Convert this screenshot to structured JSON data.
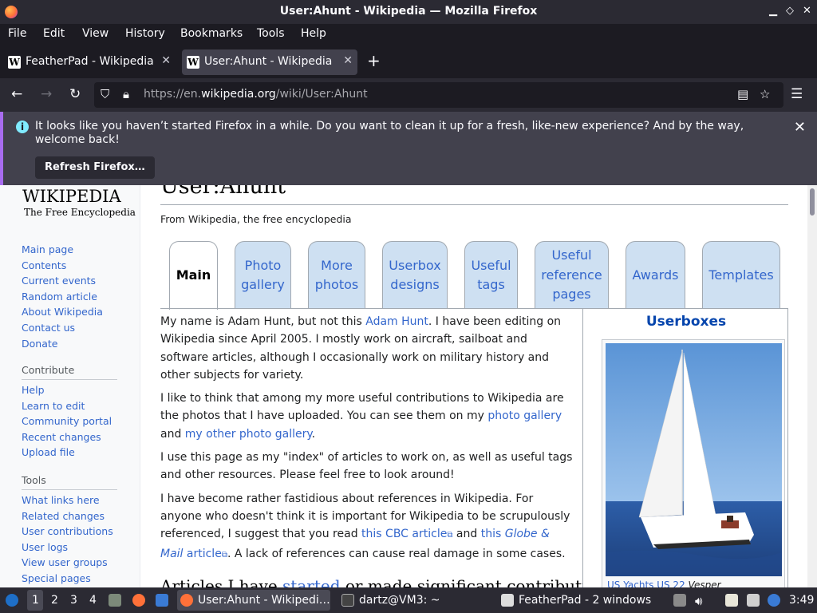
{
  "window": {
    "title": "User:Ahunt - Wikipedia — Mozilla Firefox"
  },
  "menu": [
    "File",
    "Edit",
    "View",
    "History",
    "Bookmarks",
    "Tools",
    "Help"
  ],
  "tabs": [
    {
      "label": "FeatherPad - Wikipedia",
      "active": false
    },
    {
      "label": "User:Ahunt - Wikipedia",
      "active": true
    }
  ],
  "url": {
    "prefix": "https://en.",
    "domain": "wikipedia.org",
    "path": "/wiki/User:Ahunt"
  },
  "notification": {
    "message": "It looks like you haven’t started Firefox in a while. Do you want to clean it up for a fresh, like-new experience? And by the way, welcome back!",
    "button": "Refresh Firefox…"
  },
  "wiki": {
    "logo_title": "WIKIPEDIA",
    "logo_subtitle": "The Free Encyclopedia",
    "nav": [
      "Main page",
      "Contents",
      "Current events",
      "Random article",
      "About Wikipedia",
      "Contact us",
      "Donate"
    ],
    "contribute_head": "Contribute",
    "contribute": [
      "Help",
      "Learn to edit",
      "Community portal",
      "Recent changes",
      "Upload file"
    ],
    "tools_head": "Tools",
    "tools": [
      "What links here",
      "Related changes",
      "User contributions",
      "User logs",
      "View user groups",
      "Special pages"
    ],
    "page_title": "User:Ahunt",
    "from": "From Wikipedia, the free encyclopedia",
    "user_tabs": [
      "Main",
      "Photo gallery",
      "More photos",
      "Userbox designs",
      "Useful tags",
      "Useful reference pages",
      "Awards",
      "Templates"
    ],
    "p1_a": "My name is Adam Hunt, but not this ",
    "p1_link": "Adam Hunt",
    "p1_b": ". I have been editing on Wikipedia since April 2005. I mostly work on aircraft, sailboat and software articles, although I occasionally work on military history and other subjects for variety.",
    "p2_a": "I like to think that among my more useful contributions to Wikipedia are the photos that I have uploaded. You can see them on my ",
    "p2_link1": "photo gallery",
    "p2_b": " and ",
    "p2_link2": "my other photo gallery",
    "p2_c": ".",
    "p3": "I use this page as my \"index\" of articles to work on, as well as useful tags and other resources. Please feel free to look around!",
    "p4_a": "I have become rather fastidious about references in Wikipedia. For anyone who doesn't think it is important for Wikipedia to be scrupulously referenced, I suggest that you read ",
    "p4_link1": "this CBC article",
    "p4_b": " and ",
    "p4_link2a": "this ",
    "p4_link2i": "Globe & Mail",
    "p4_link2b": " article",
    "p4_c": ". A lack of references can cause real damage in some cases.",
    "h2_a": "Articles I have ",
    "h2_link": "started",
    "h2_b": " or made significant contributions",
    "userbox_title": "Userboxes",
    "caption_link": "US Yachts US 22",
    "caption_italic": " Vesper"
  },
  "taskbar": {
    "workspaces": [
      "1",
      "2",
      "3",
      "4"
    ],
    "windows": [
      "User:Ahunt - Wikipedi…",
      "dartz@VM3: ~",
      "FeatherPad - 2 windows"
    ],
    "clock": "3:49"
  }
}
